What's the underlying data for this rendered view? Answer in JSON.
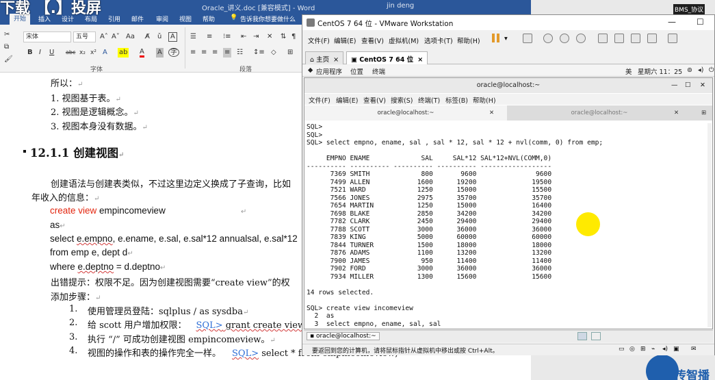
{
  "word": {
    "overlay_text": "下载 【.】投屏",
    "doc_title": "Oracle_讲义.doc [兼容模式] - Word",
    "user": "jin deng",
    "tabs": [
      "开始",
      "插入",
      "设计",
      "布局",
      "引用",
      "邮件",
      "审阅",
      "视图",
      "帮助"
    ],
    "tell_me": "告诉我你想要做什么",
    "font_name": "宋体",
    "font_size": "五号",
    "group_font": "字体",
    "group_paragraph": "段落",
    "doc_lines": {
      "intro": "所以：",
      "points": [
        "1.  视图基于表。",
        "2.  视图是逻辑概念。",
        "3.  视图本身没有数据。"
      ],
      "heading": "12.1.1 创建视图",
      "desc1": "创建语法与创建表类似，不过这里边定义换成了子查询，比如",
      "desc2": "年收入的信息：",
      "code1_kw": "create view",
      "code1_rest": " empincomeview",
      "code2": "as",
      "code3_a": "select ",
      "code3_b": "e.empno",
      "code3_c": ", e.ename, e.sal, e.sal*12 annualsal, e.sal*12",
      "code4": "from emp e, dept d",
      "code5_a": "where ",
      "code5_b": "e.deptno",
      "code5_c": " = d.deptno",
      "error_line": "出错提示：权限不足。因为创建视图需要“create view”的权",
      "add_steps": "添加步骤：",
      "step1_num": "1.",
      "step1": "使用管理员登陆：sqlplus / as sysdba",
      "step2_num": "2.",
      "step2_a": "给 scott 用户增加权限：",
      "step2_b": "SQL>",
      "step2_c": " grant create view",
      "step3_num": "3.",
      "step3": "执行 “/” 可成功创建视图 empincomeview。",
      "step4_num": "4.",
      "step4_a": "视图的操作和表的操作完全一样。",
      "step4_b": "SQL>",
      "step4_c": " select * from empincomeview;"
    }
  },
  "right_strip": {
    "badge": "BMS_协议",
    "brand": "传智播"
  },
  "vmware": {
    "title": "CentOS 7 64 位 - VMware Workstation",
    "menu": [
      "文件(F)",
      "编辑(E)",
      "查看(V)",
      "虚拟机(M)",
      "选项卡(T)",
      "帮助(H)"
    ],
    "tabs": [
      "主页",
      "CentOS 7 64 位"
    ],
    "gnome": {
      "apps": "应用程序",
      "places": "位置",
      "terminal": "终端",
      "lang": "美",
      "clock": "星期六 11：25"
    },
    "terminal": {
      "title": "oracle@localhost:~",
      "menu": [
        "文件(F)",
        "编辑(E)",
        "查看(V)",
        "搜索(S)",
        "终端(T)",
        "标签(B)",
        "帮助(H)"
      ],
      "tabs": [
        "oracle@localhost:~",
        "oracle@localhost:~"
      ],
      "lines": [
        "SQL>",
        "SQL>",
        "SQL> select empno, ename, sal , sal * 12, sal * 12 + nvl(comm, 0) from emp;",
        "",
        "     EMPNO ENAME             SAL     SAL*12 SAL*12+NVL(COMM,0)",
        "---------- ---------- ---------- ---------- ------------------",
        "      7369 SMITH             800       9600               9600",
        "      7499 ALLEN            1600      19200              19500",
        "      7521 WARD             1250      15000              15500",
        "      7566 JONES            2975      35700              35700",
        "      7654 MARTIN           1250      15000              16400",
        "      7698 BLAKE            2850      34200              34200",
        "      7782 CLARK            2450      29400              29400",
        "      7788 SCOTT            3000      36000              36000",
        "      7839 KING             5000      60000              60000",
        "      7844 TURNER           1500      18000              18000",
        "      7876 ADAMS            1100      13200              13200",
        "      7900 JAMES             950      11400              11400",
        "      7902 FORD             3000      36000              36000",
        "      7934 MILLER           1300      15600              15600",
        "",
        "14 rows selected.",
        "",
        "SQL> create view incomeview",
        "  2  as",
        "  3  select empno, ename, sal, sal"
      ]
    },
    "taskbar_item": "oracle@localhost:~",
    "status": "要返回到您的计算机，请将鼠标指针从虚拟机中移出或按 Ctrl+Alt。"
  }
}
